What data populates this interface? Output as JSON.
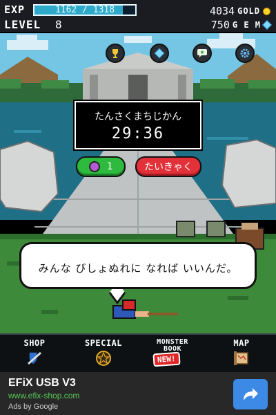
{
  "hud": {
    "exp_label": "EXP",
    "exp_text": "1162 / 1318",
    "exp_fraction": 0.88,
    "level_label": "LEVEL",
    "level_value": "8",
    "gold_value": "4034",
    "gold_label": "GOLD",
    "gem_value": "750",
    "gem_label": "G E M"
  },
  "scene": {
    "top_buttons": [
      "trophy-icon",
      "gem-icon",
      "chat-icon",
      "settings-icon"
    ],
    "timer_title": "たんさくまちじかん",
    "timer_value": "29:36",
    "potion_count": "1",
    "retreat_label": "たいきゃく",
    "speech": "みんな  びしょぬれに  なれば いいんだ。"
  },
  "nav": {
    "shop": "SHOP",
    "special": "SPECIAL",
    "monster_book_line1": "MONSTER",
    "monster_book_line2": "BOOK",
    "new_badge": "NEW!",
    "map": "MAP"
  },
  "ad": {
    "title": "EFiX USB V3",
    "url": "www.efix-shop.com",
    "by": "Ads by Google"
  },
  "colors": {
    "exp_fill": "#2fa9c9",
    "green_button": "#2eba3f",
    "red_button": "#e3313a",
    "ad_link": "#55c857",
    "ad_button": "#3c8ae6"
  }
}
